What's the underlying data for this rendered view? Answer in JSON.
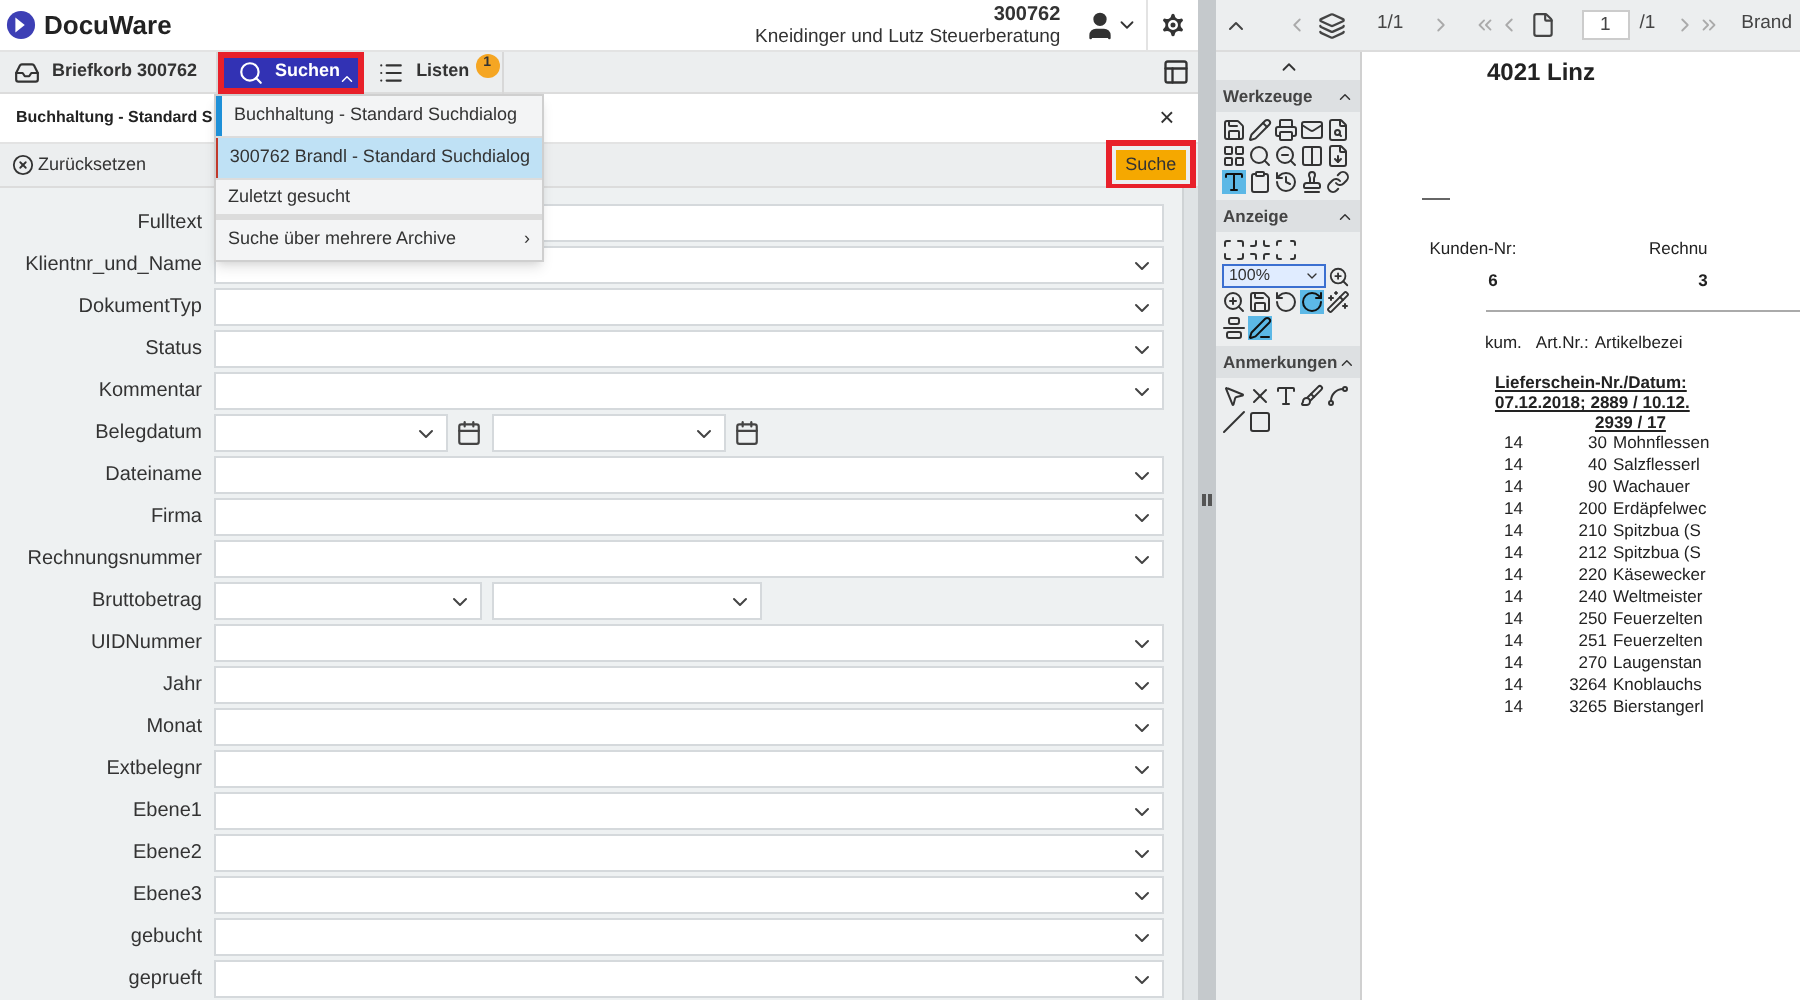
{
  "header": {
    "logo": "DocuWare",
    "account_number": "300762",
    "company": "Kneidinger und Lutz Steuerberatung"
  },
  "tabs": [
    {
      "label": "Briefkorb 300762",
      "selected": false,
      "highlighted": false
    },
    {
      "label": "Suchen",
      "selected": true,
      "highlighted": true
    },
    {
      "label": "Listen",
      "selected": false,
      "highlighted": false,
      "badge": "1"
    }
  ],
  "search_menu": {
    "items": [
      {
        "kind": "dialog",
        "label": "Buchhaltung - Standard Suchdialog",
        "color": "#1e90d8",
        "selected": false
      },
      {
        "kind": "dialog",
        "label": "300762 Brandl - Standard Suchdialog",
        "color": "#c0392b",
        "selected": true
      },
      {
        "kind": "plain",
        "label": "Zuletzt gesucht",
        "selected": false
      },
      {
        "kind": "submenu",
        "label": "Suche über mehrere Archive",
        "arrow": "›",
        "selected": false
      }
    ]
  },
  "dialog": {
    "title": "Buchhaltung - Standard S",
    "close": "×",
    "reset": "Zurücksetzen",
    "search_button": {
      "label": "Suche",
      "highlighted": true
    },
    "fields": [
      {
        "label": "Fulltext",
        "kind": "text"
      },
      {
        "label": "Klientnr_und_Name",
        "kind": "select"
      },
      {
        "label": "DokumentTyp",
        "kind": "select"
      },
      {
        "label": "Status",
        "kind": "select"
      },
      {
        "label": "Kommentar",
        "kind": "select"
      },
      {
        "label": "Belegdatum",
        "kind": "date_range"
      },
      {
        "label": "Dateiname",
        "kind": "select"
      },
      {
        "label": "Firma",
        "kind": "select"
      },
      {
        "label": "Rechnungsnummer",
        "kind": "select"
      },
      {
        "label": "Bruttobetrag",
        "kind": "select_range"
      },
      {
        "label": "UIDNummer",
        "kind": "select"
      },
      {
        "label": "Jahr",
        "kind": "select"
      },
      {
        "label": "Monat",
        "kind": "select"
      },
      {
        "label": "Extbelegnr",
        "kind": "select"
      },
      {
        "label": "Ebene1",
        "kind": "select"
      },
      {
        "label": "Ebene2",
        "kind": "select"
      },
      {
        "label": "Ebene3",
        "kind": "select"
      },
      {
        "label": "gebucht",
        "kind": "select"
      },
      {
        "label": "geprueft",
        "kind": "select"
      }
    ]
  },
  "viewer_toolbar": {
    "layer_pages": "1/1",
    "page": "1",
    "page_total": "/1",
    "label": "Brand"
  },
  "toolbox": {
    "sections": [
      {
        "title": "Werkzeuge",
        "tools": [
          {
            "selected": false
          },
          {
            "selected": false
          },
          {
            "selected": false
          },
          {
            "selected": false
          },
          {
            "selected": false
          },
          {
            "selected": false
          },
          {
            "selected": false
          },
          {
            "selected": false
          },
          {
            "selected": false
          },
          {
            "selected": false
          },
          {
            "selected": true
          },
          {
            "selected": false
          },
          {
            "selected": false
          },
          {
            "selected": false
          },
          {
            "selected": false
          }
        ]
      },
      {
        "title": "Anzeige",
        "zoom": "100%",
        "tools": [
          {
            "selected": false
          },
          {
            "selected": false
          },
          {
            "selected": false
          },
          {
            "selected": false
          },
          {
            "selected": false
          },
          {
            "selected": false
          },
          {
            "selected": true
          },
          {
            "selected": false
          },
          {
            "selected": false
          },
          {
            "selected": true
          }
        ]
      },
      {
        "title": "Anmerkungen",
        "tools": [
          {
            "selected": false
          },
          {
            "selected": false
          },
          {
            "selected": false
          },
          {
            "selected": false
          },
          {
            "selected": false
          },
          {
            "selected": false
          },
          {
            "selected": false
          }
        ]
      }
    ]
  },
  "document": {
    "city": "4021 Linz",
    "customer_label": "Kunden-Nr:",
    "invoice_label": "Rechnu",
    "customer_value": "6",
    "invoice_value": "3",
    "col_1": "kum.",
    "col_2": "Art.Nr.:",
    "col_3": "Artikelbezei",
    "delivery_heading": "Lieferschein-Nr./Datum:",
    "delivery_line_1": "07.12.2018; 2889 / 10.12.",
    "delivery_line_2": "2939 / 17",
    "rows": [
      [
        "14",
        "30",
        "Mohnflessen"
      ],
      [
        "14",
        "40",
        "Salzflesserl"
      ],
      [
        "14",
        "90",
        "Wachauer"
      ],
      [
        "14",
        "200",
        "Erdäpfelwec"
      ],
      [
        "14",
        "210",
        "Spitzbua (S"
      ],
      [
        "14",
        "212",
        "Spitzbua (S"
      ],
      [
        "14",
        "220",
        "Käsewecker"
      ],
      [
        "14",
        "240",
        "Weltmeister"
      ],
      [
        "14",
        "250",
        "Feuerzelten"
      ],
      [
        "14",
        "251",
        "Feuerzelten"
      ],
      [
        "14",
        "270",
        "Laugenstan"
      ],
      [
        "14",
        "3264",
        "Knoblauchs"
      ],
      [
        "14",
        "3265",
        "Bierstangerl"
      ]
    ]
  }
}
